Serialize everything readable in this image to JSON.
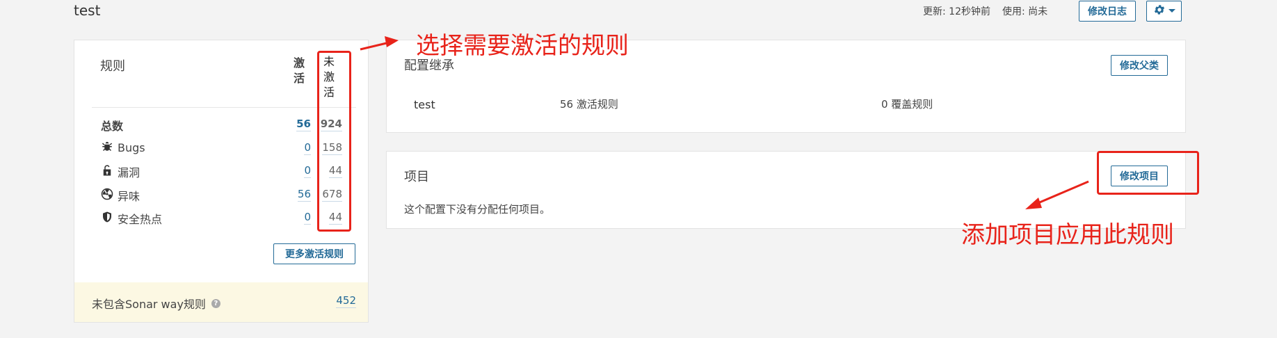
{
  "header": {
    "title": "test",
    "updated": "更新: 12秒钟前",
    "usage": "使用: 尚未",
    "changelog_button": "修改日志"
  },
  "rules": {
    "heading": "规则",
    "col_active": [
      "激",
      "活"
    ],
    "col_inactive": [
      "未",
      "激",
      "活"
    ],
    "rows": [
      {
        "label": "总数",
        "icon": "",
        "active": "56",
        "inactive": "924"
      },
      {
        "label": "Bugs",
        "icon": "bug-icon",
        "active": "0",
        "inactive": "158"
      },
      {
        "label": "漏洞",
        "icon": "lock-open-icon",
        "active": "0",
        "inactive": "44"
      },
      {
        "label": "异味",
        "icon": "radiation-icon",
        "active": "56",
        "inactive": "678"
      },
      {
        "label": "安全热点",
        "icon": "shield-icon",
        "active": "0",
        "inactive": "44"
      }
    ],
    "more_button": "更多激活规则",
    "missing_label": "未包含Sonar way规则",
    "missing_count": "452"
  },
  "inheritance": {
    "heading": "配置继承",
    "change_parent_button": "修改父类",
    "profile_name": "test",
    "active_rules": "56 激活规则",
    "override_rules": "0 覆盖规则"
  },
  "projects": {
    "heading": "项目",
    "change_button": "修改项目",
    "empty_text": "这个配置下没有分配任何项目。"
  },
  "annotations": {
    "select_rules": "选择需要激活的规则",
    "add_project": "添加项目应用此规则"
  },
  "colors": {
    "accent": "#236a97",
    "annotation": "#e8231a",
    "warning_bg": "#fcf8e3"
  }
}
